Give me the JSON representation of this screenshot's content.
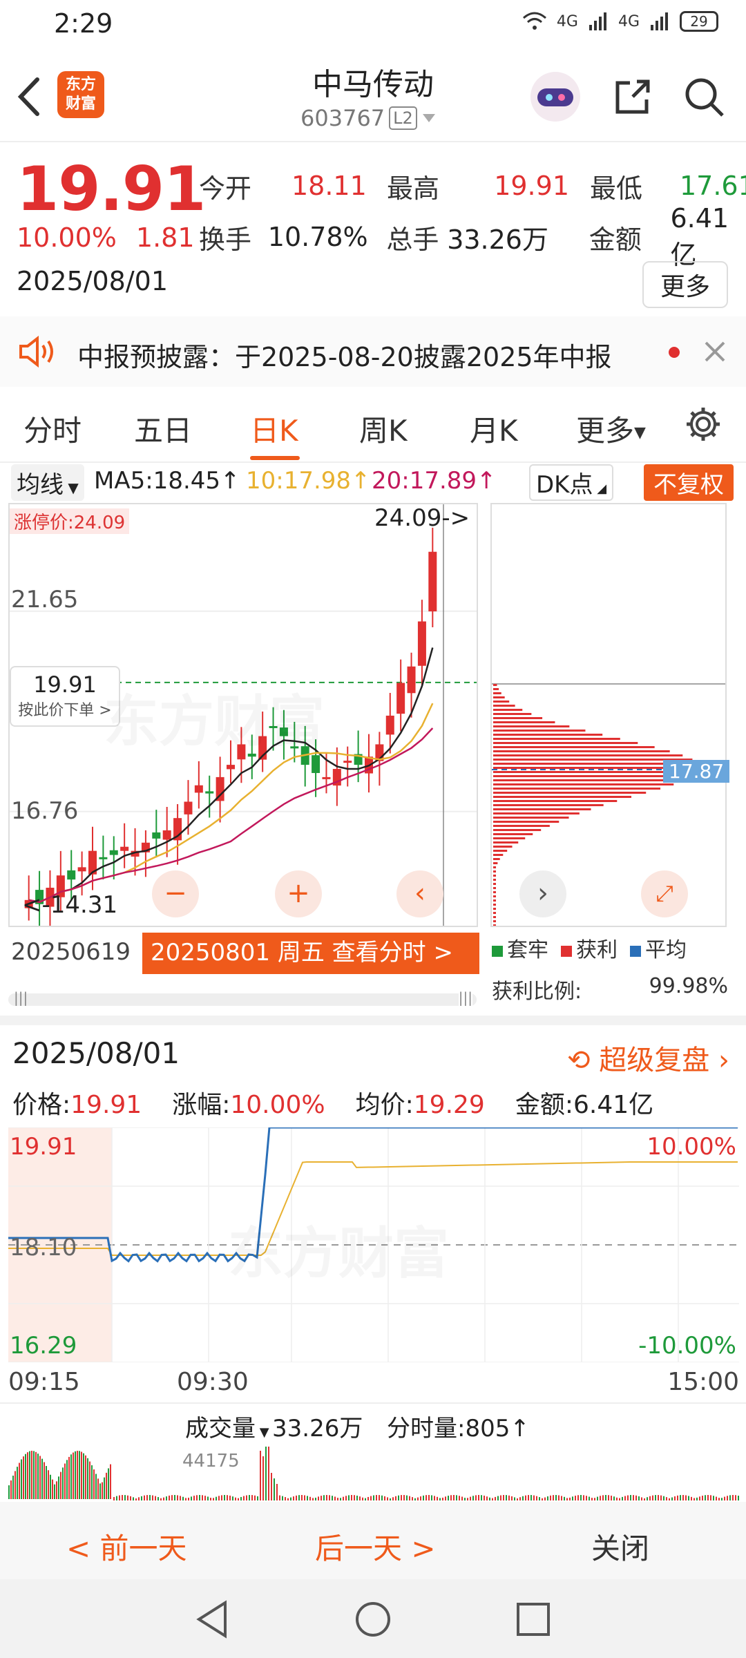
{
  "status": {
    "time": "2:29",
    "signal1": "4G",
    "signal2": "4G",
    "battery": "29"
  },
  "header": {
    "logo_line1": "东方",
    "logo_line2": "财富",
    "name": "中马传动",
    "code": "603767",
    "level": "L2"
  },
  "quote": {
    "price": "19.91",
    "change_pct": "10.00%",
    "change": "1.81",
    "date": "2025/08/01",
    "open_label": "今开",
    "open": "18.11",
    "high_label": "最高",
    "high": "19.91",
    "low_label": "最低",
    "low": "17.61",
    "turnover_label": "换手",
    "turnover": "10.78%",
    "volume_label": "总手",
    "volume": "33.26万",
    "amount_label": "金额",
    "amount": "6.41亿",
    "more": "更多"
  },
  "notice": {
    "text": "中报预披露：于2025-08-20披露2025年中报"
  },
  "tabs": [
    "分时",
    "五日",
    "日K",
    "周K",
    "月K",
    "更多"
  ],
  "ma": {
    "selector": "均线",
    "ma5": "MA5:18.45↑",
    "ma10": "10:17.98↑",
    "ma20": "20:17.89↑",
    "dk": "DK点",
    "adjust": "不复权"
  },
  "kline": {
    "limit_label": "涨停价:24.09",
    "arrow_label": "24.09->",
    "axis_top": "24.09",
    "axis_mid": "21.65",
    "axis_low": "16.76",
    "axis_bottom": "14.31",
    "min_label": "<-14.31",
    "cursor_price": "19.91",
    "cursor_hint": "按此价下单 >",
    "chip_avg": "17.87",
    "start_date": "20250619",
    "sel_date_btn": "20250801 周五 查看分时 >"
  },
  "chip_legend": {
    "trap": "套牢",
    "profit": "获利",
    "avg": "平均",
    "ratio_label": "获利比例:",
    "ratio": "99.98%"
  },
  "intraday": {
    "date": "2025/08/01",
    "super_label": "超级复盘",
    "price_label": "价格:",
    "price": "19.91",
    "pct_label": "涨幅:",
    "pct": "10.00%",
    "avg_label": "均价:",
    "avg": "19.29",
    "amt_label": "金额:",
    "amt": "6.41亿",
    "y_top": "19.91",
    "y_mid": "18.10",
    "y_bot": "16.29",
    "r_top": "10.00%",
    "r_bot": "-10.00%",
    "t_start": "09:15",
    "t_mid": "09:30",
    "t_end": "15:00"
  },
  "volume": {
    "selector": "成交量",
    "total": "33.26万",
    "tick_label": "分时量:805↑",
    "max": "44175"
  },
  "bottom": {
    "prev": "< 前一天",
    "next": "后一天 >",
    "close": "关闭"
  },
  "colors": {
    "up": "#e03030",
    "down": "#1e9a3a",
    "accent": "#ef5a1b",
    "avg_line": "#e8b130",
    "price_line": "#2a6fb8"
  }
}
